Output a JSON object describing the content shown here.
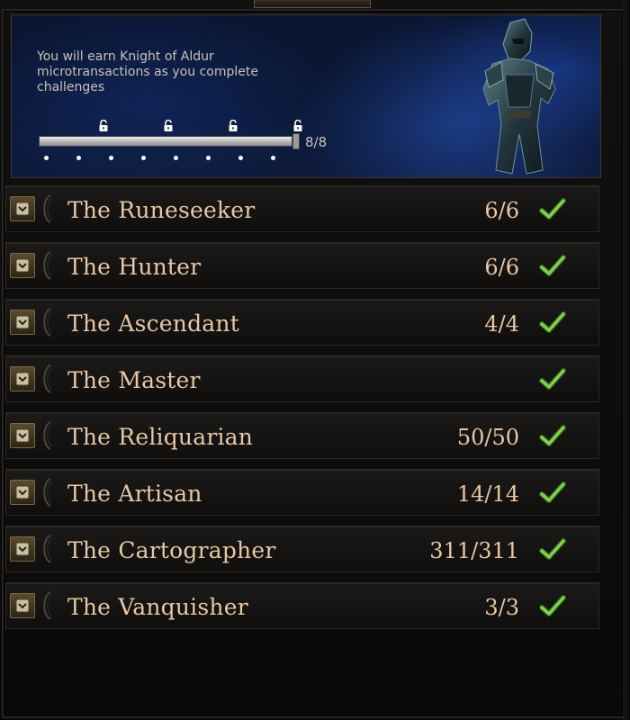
{
  "banner": {
    "line1": "You will earn Knight of Aldur",
    "line2": "microtransactions as you complete",
    "line3": "challenges",
    "progress_text": "8/8",
    "progress_fraction": 1.0,
    "reward_unlocks": 4
  },
  "rows": [
    {
      "title": "The Runeseeker",
      "count": "6/6",
      "complete": true
    },
    {
      "title": "The Hunter",
      "count": "6/6",
      "complete": true
    },
    {
      "title": "The Ascendant",
      "count": "4/4",
      "complete": true
    },
    {
      "title": "The Master",
      "count": "",
      "complete": true
    },
    {
      "title": "The Reliquarian",
      "count": "50/50",
      "complete": true
    },
    {
      "title": "The Artisan",
      "count": "14/14",
      "complete": true
    },
    {
      "title": "The Cartographer",
      "count": "311/311",
      "complete": true
    },
    {
      "title": "The Vanquisher",
      "count": "3/3",
      "complete": true
    }
  ],
  "icons": {
    "expand": "chevron-down-icon",
    "complete": "checkmark-icon",
    "unlock": "unlocked-padlock-icon"
  },
  "colors": {
    "title_text": "#e9c7a3",
    "check_green": "#7fd24a",
    "banner_blue": "#0b1633"
  }
}
